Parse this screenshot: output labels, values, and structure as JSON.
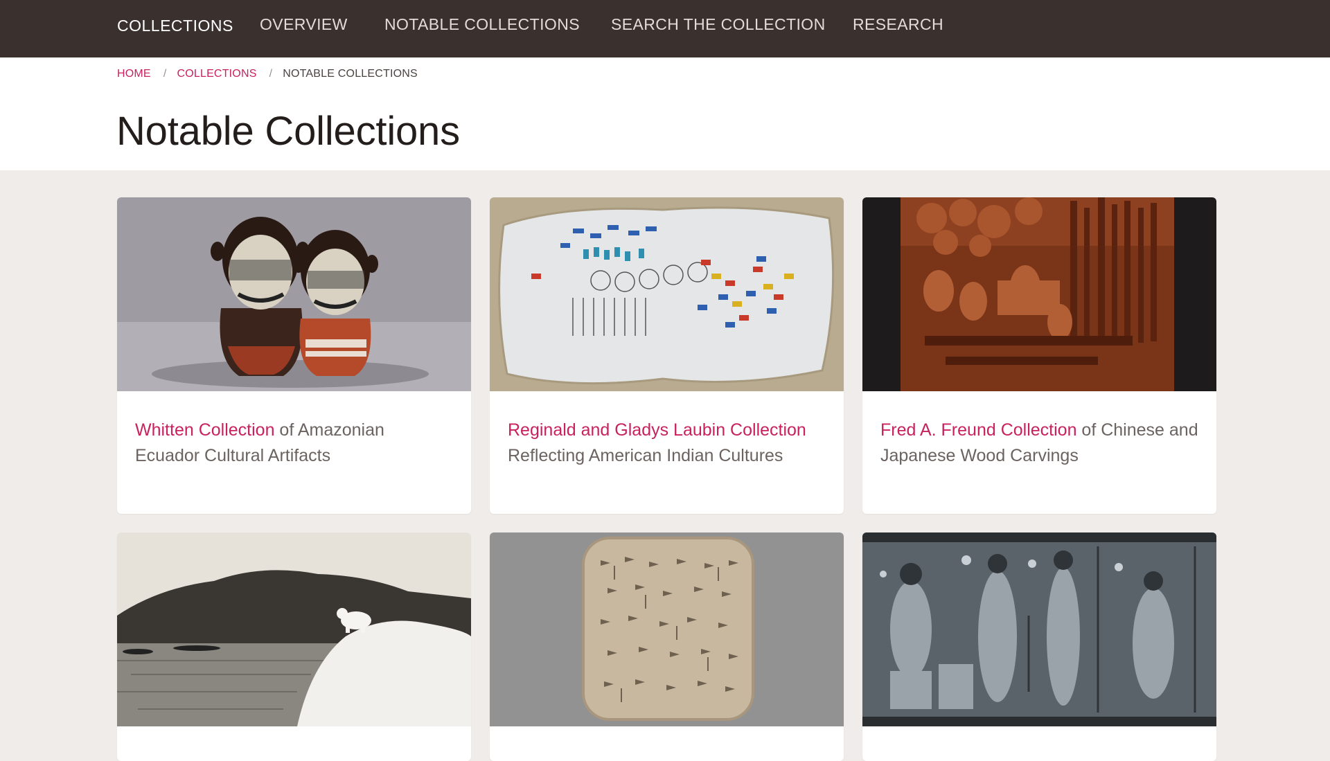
{
  "nav": {
    "brand": "COLLECTIONS",
    "links": [
      "OVERVIEW",
      "NOTABLE COLLECTIONS",
      "SEARCH THE COLLECTION",
      "RESEARCH"
    ]
  },
  "breadcrumb": {
    "items": [
      "HOME",
      "COLLECTIONS"
    ],
    "separator": "/",
    "current": "NOTABLE COLLECTIONS"
  },
  "page": {
    "title": "Notable Collections"
  },
  "cards": [
    {
      "link": "Whitten Collection",
      "text": " of Amazonian Ecuador Cultural Artifacts",
      "image": "ceramic-figures-image"
    },
    {
      "link": "Reginald and Gladys Laubin Collection",
      "text": " Reflecting American Indian Cultures",
      "image": "painted-hide-image"
    },
    {
      "link": "Fred A. Freund Collection",
      "text": " of Chinese and Japanese Wood Carvings",
      "image": "wood-carving-image"
    },
    {
      "link": "",
      "text": "",
      "image": "arctic-photo-image"
    },
    {
      "link": "",
      "text": "",
      "image": "cuneiform-tablet-image"
    },
    {
      "link": "",
      "text": "",
      "image": "cylinder-seal-image"
    }
  ],
  "colors": {
    "nav_bg": "#3a312e",
    "accent": "#c8215d",
    "page_bg": "#f0ecea"
  }
}
